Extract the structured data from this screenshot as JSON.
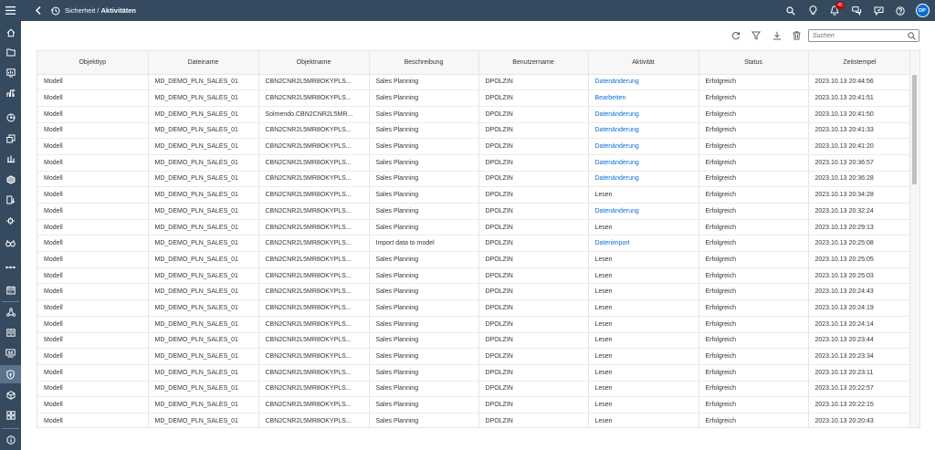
{
  "shell": {
    "title_prefix": "Sicherheit / ",
    "title_main": "Aktivitäten",
    "notification_count": "45",
    "avatar_initials": "DP",
    "icons": [
      "menu-icon",
      "back-icon",
      "activities-app-icon",
      "search-icon",
      "lightbulb-icon",
      "bell-icon",
      "chat-icon",
      "feedback-icon",
      "help-icon"
    ]
  },
  "sidenav": {
    "items": [
      "home-icon",
      "folder-icon",
      "stories-icon",
      "analytic-app-icon",
      "insights-icon",
      "multi-action-icon",
      "modeler-icon",
      "data-analyzer-icon",
      "data-action-icon",
      "connections-icon",
      "explorer-icon",
      "workflow-icon",
      "calendar-icon",
      "network-icon",
      "catalog-icon",
      "digital-boardroom-icon",
      "security-icon",
      "transport-icon",
      "system-icon",
      "info-icon"
    ],
    "active": "security-icon"
  },
  "toolbar": {
    "icons": [
      "refresh-icon",
      "filter-icon",
      "download-icon",
      "delete-icon"
    ],
    "search_placeholder": "Suchen"
  },
  "table": {
    "columns": [
      "Objekttyp",
      "Dateiname",
      "Objektname",
      "Beschreibung",
      "Benutzername",
      "Aktivität",
      "Status",
      "Zeitstempel"
    ],
    "link_color": "#0a6ed1",
    "rows": [
      [
        "Modell",
        "MD_DEMO_PLN_SALES_01",
        "CBN2CNR2L5MR8OKYPLS...",
        "Sales Planning",
        "DPOLZIN",
        "Datenänderung",
        "Erfolgreich",
        "2023.10.13 20:44:56"
      ],
      [
        "Modell",
        "MD_DEMO_PLN_SALES_01",
        "CBN2CNR2L5MR8OKYPLS...",
        "Sales Planning",
        "DPOLZIN",
        "Bearbeiten",
        "Erfolgreich",
        "2023.10.13 20:41:51"
      ],
      [
        "Modell",
        "MD_DEMO_PLN_SALES_01",
        "Solmendo.CBN2CNR2L5MR...",
        "Sales Planning",
        "DPOLZIN",
        "Datenänderung",
        "Erfolgreich",
        "2023.10.13 20:41:50"
      ],
      [
        "Modell",
        "MD_DEMO_PLN_SALES_01",
        "CBN2CNR2L5MR8OKYPLS...",
        "Sales Planning",
        "DPOLZIN",
        "Datenänderung",
        "Erfolgreich",
        "2023.10.13 20:41:33"
      ],
      [
        "Modell",
        "MD_DEMO_PLN_SALES_01",
        "CBN2CNR2L5MR8OKYPLS...",
        "Sales Planning",
        "DPOLZIN",
        "Datenänderung",
        "Erfolgreich",
        "2023.10.13 20:41:20"
      ],
      [
        "Modell",
        "MD_DEMO_PLN_SALES_01",
        "CBN2CNR2L5MR8OKYPLS...",
        "Sales Planning",
        "DPOLZIN",
        "Datenänderung",
        "Erfolgreich",
        "2023.10.13 20:36:57"
      ],
      [
        "Modell",
        "MD_DEMO_PLN_SALES_01",
        "CBN2CNR2L5MR8OKYPLS...",
        "Sales Planning",
        "DPOLZIN",
        "Datenänderung",
        "Erfolgreich",
        "2023.10.13 20:36:28"
      ],
      [
        "Modell",
        "MD_DEMO_PLN_SALES_01",
        "CBN2CNR2L5MR8OKYPLS...",
        "Sales Planning",
        "DPOLZIN",
        "Lesen",
        "Erfolgreich",
        "2023.10.13 20:34:28"
      ],
      [
        "Modell",
        "MD_DEMO_PLN_SALES_01",
        "CBN2CNR2L5MR8OKYPLS...",
        "Sales Planning",
        "DPOLZIN",
        "Datenänderung",
        "Erfolgreich",
        "2023.10.13 20:32:24"
      ],
      [
        "Modell",
        "MD_DEMO_PLN_SALES_01",
        "CBN2CNR2L5MR8OKYPLS...",
        "Sales Planning",
        "DPOLZIN",
        "Lesen",
        "Erfolgreich",
        "2023.10.13 20:29:13"
      ],
      [
        "Modell",
        "MD_DEMO_PLN_SALES_01",
        "CBN2CNR2L5MR8OKYPLS...",
        "Import data to model",
        "DPOLZIN",
        "Datenimport",
        "Erfolgreich",
        "2023.10.13 20:25:08"
      ],
      [
        "Modell",
        "MD_DEMO_PLN_SALES_01",
        "CBN2CNR2L5MR8OKYPLS...",
        "Sales Planning",
        "DPOLZIN",
        "Lesen",
        "Erfolgreich",
        "2023.10.13 20:25:05"
      ],
      [
        "Modell",
        "MD_DEMO_PLN_SALES_01",
        "CBN2CNR2L5MR8OKYPLS...",
        "Sales Planning",
        "DPOLZIN",
        "Lesen",
        "Erfolgreich",
        "2023.10.13 20:25:03"
      ],
      [
        "Modell",
        "MD_DEMO_PLN_SALES_01",
        "CBN2CNR2L5MR8OKYPLS...",
        "Sales Planning",
        "DPOLZIN",
        "Lesen",
        "Erfolgreich",
        "2023.10.13 20:24:43"
      ],
      [
        "Modell",
        "MD_DEMO_PLN_SALES_01",
        "CBN2CNR2L5MR8OKYPLS...",
        "Sales Planning",
        "DPOLZIN",
        "Lesen",
        "Erfolgreich",
        "2023.10.13 20:24:19"
      ],
      [
        "Modell",
        "MD_DEMO_PLN_SALES_01",
        "CBN2CNR2L5MR8OKYPLS...",
        "Sales Planning",
        "DPOLZIN",
        "Lesen",
        "Erfolgreich",
        "2023.10.13 20:24:14"
      ],
      [
        "Modell",
        "MD_DEMO_PLN_SALES_01",
        "CBN2CNR2L5MR8OKYPLS...",
        "Sales Planning",
        "DPOLZIN",
        "Lesen",
        "Erfolgreich",
        "2023.10.13 20:23:44"
      ],
      [
        "Modell",
        "MD_DEMO_PLN_SALES_01",
        "CBN2CNR2L5MR8OKYPLS...",
        "Sales Planning",
        "DPOLZIN",
        "Lesen",
        "Erfolgreich",
        "2023.10.13 20:23:34"
      ],
      [
        "Modell",
        "MD_DEMO_PLN_SALES_01",
        "CBN2CNR2L5MR8OKYPLS...",
        "Sales Planning",
        "DPOLZIN",
        "Lesen",
        "Erfolgreich",
        "2023.10.13 20:23:11"
      ],
      [
        "Modell",
        "MD_DEMO_PLN_SALES_01",
        "CBN2CNR2L5MR8OKYPLS...",
        "Sales Planning",
        "DPOLZIN",
        "Lesen",
        "Erfolgreich",
        "2023.10.13 20:22:57"
      ],
      [
        "Modell",
        "MD_DEMO_PLN_SALES_01",
        "CBN2CNR2L5MR8OKYPLS...",
        "Sales Planning",
        "DPOLZIN",
        "Lesen",
        "Erfolgreich",
        "2023.10.13 20:22:15"
      ],
      [
        "Modell",
        "MD_DEMO_PLN_SALES_01",
        "CBN2CNR2L5MR8OKYPLS...",
        "Sales Planning",
        "DPOLZIN",
        "Lesen",
        "Erfolgreich",
        "2023.10.13 20:20:43"
      ]
    ]
  }
}
